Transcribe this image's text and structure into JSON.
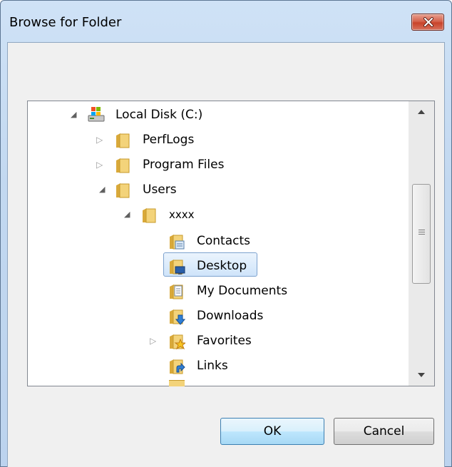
{
  "window": {
    "title": "Browse for Folder"
  },
  "tree": {
    "rows": [
      {
        "label": "Local Disk (C:)",
        "expander": "expanded",
        "icon": "local-disk-icon"
      },
      {
        "label": "PerfLogs",
        "expander": "collapsed",
        "icon": "folder-icon"
      },
      {
        "label": "Program Files",
        "expander": "collapsed",
        "icon": "folder-icon"
      },
      {
        "label": "Users",
        "expander": "expanded",
        "icon": "folder-icon"
      },
      {
        "label": "xxxx",
        "expander": "expanded",
        "icon": "folder-icon"
      },
      {
        "label": "Contacts",
        "expander": "none",
        "icon": "contacts-folder-icon"
      },
      {
        "label": "Desktop",
        "expander": "none",
        "icon": "desktop-folder-icon",
        "selected": true
      },
      {
        "label": "My Documents",
        "expander": "none",
        "icon": "documents-folder-icon"
      },
      {
        "label": "Downloads",
        "expander": "none",
        "icon": "downloads-folder-icon"
      },
      {
        "label": "Favorites",
        "expander": "collapsed",
        "icon": "favorites-folder-icon"
      },
      {
        "label": "Links",
        "expander": "none",
        "icon": "links-folder-icon"
      }
    ]
  },
  "buttons": {
    "ok": "OK",
    "cancel": "Cancel"
  },
  "colors": {
    "selection": "#cfe4fa",
    "selection_border": "#7da2ce",
    "default_button": "#bee6fd",
    "close_button": "#c8432a"
  }
}
